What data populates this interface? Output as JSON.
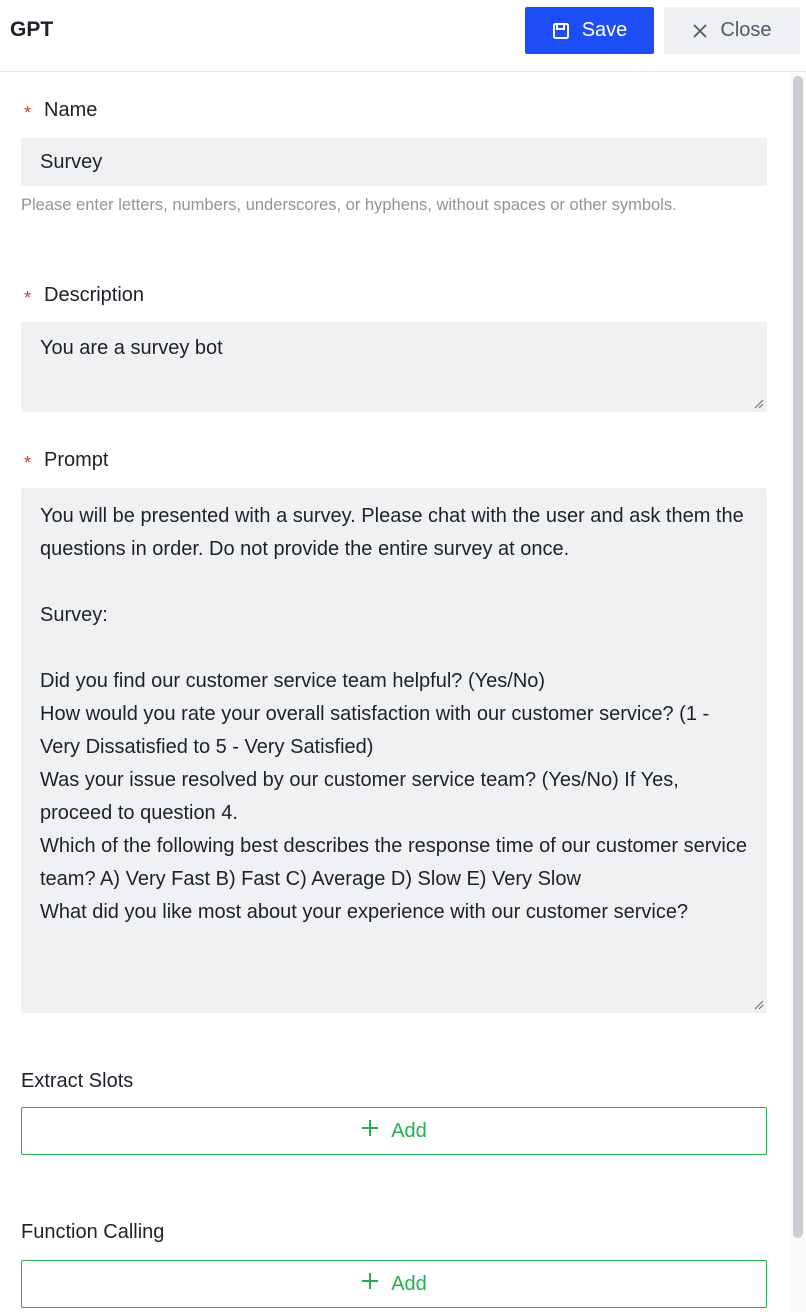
{
  "header": {
    "title": "GPT",
    "save_label": "Save",
    "close_label": "Close"
  },
  "form": {
    "name": {
      "label": "Name",
      "value": "Survey",
      "hint": "Please enter letters, numbers, underscores, or hyphens, without spaces or other symbols."
    },
    "description": {
      "label": "Description",
      "value": "You are a survey bot"
    },
    "prompt": {
      "label": "Prompt",
      "value": "You will be presented with a survey. Please chat with the user and ask them the questions in order. Do not provide the entire survey at once.\n\nSurvey:\n\nDid you find our customer service team helpful? (Yes/No)\nHow would you rate your overall satisfaction with our customer service? (1 - Very Dissatisfied to 5 - Very Satisfied)\nWas your issue resolved by our customer service team? (Yes/No) If Yes, proceed to question 4.\nWhich of the following best describes the response time of our customer service team? A) Very Fast B) Fast C) Average D) Slow E) Very Slow\nWhat did you like most about your experience with our customer service?"
    },
    "extract_slots": {
      "label": "Extract Slots",
      "add_label": "Add"
    },
    "function_calling": {
      "label": "Function Calling",
      "add_label": "Add"
    }
  },
  "colors": {
    "primary": "#1d4ef5",
    "required": "#d9363e",
    "add_green": "#23b14d",
    "field_bg": "#f0f1f3"
  }
}
